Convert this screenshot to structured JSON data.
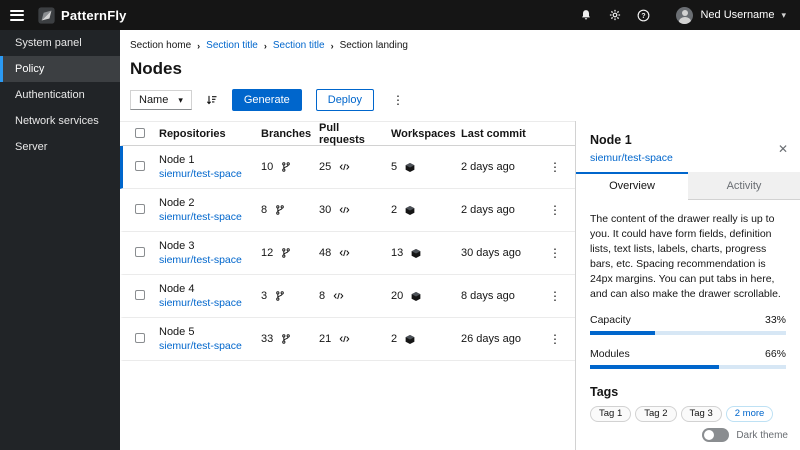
{
  "masthead": {
    "brand": "PatternFly",
    "username": "Ned Username"
  },
  "sidebar": {
    "items": [
      {
        "label": "System panel"
      },
      {
        "label": "Policy"
      },
      {
        "label": "Authentication"
      },
      {
        "label": "Network services"
      },
      {
        "label": "Server"
      }
    ]
  },
  "breadcrumb": {
    "items": [
      {
        "label": "Section home"
      },
      {
        "label": "Section title"
      },
      {
        "label": "Section title"
      },
      {
        "label": "Section landing"
      }
    ]
  },
  "page": {
    "title": "Nodes"
  },
  "toolbar": {
    "filter_label": "Name",
    "generate_label": "Generate",
    "deploy_label": "Deploy"
  },
  "table": {
    "headers": {
      "repositories": "Repositories",
      "branches": "Branches",
      "pulls": "Pull requests",
      "workspaces": "Workspaces",
      "last_commit": "Last commit"
    },
    "rows": [
      {
        "name": "Node 1",
        "repo": "siemur/test-space",
        "branches": "10",
        "pulls": "25",
        "workspaces": "5",
        "commit": "2 days ago"
      },
      {
        "name": "Node 2",
        "repo": "siemur/test-space",
        "branches": "8",
        "pulls": "30",
        "workspaces": "2",
        "commit": "2 days ago"
      },
      {
        "name": "Node 3",
        "repo": "siemur/test-space",
        "branches": "12",
        "pulls": "48",
        "workspaces": "13",
        "commit": "30 days ago"
      },
      {
        "name": "Node 4",
        "repo": "siemur/test-space",
        "branches": "3",
        "pulls": "8",
        "workspaces": "20",
        "commit": "8 days ago"
      },
      {
        "name": "Node 5",
        "repo": "siemur/test-space",
        "branches": "33",
        "pulls": "21",
        "workspaces": "2",
        "commit": "26 days ago"
      }
    ]
  },
  "drawer": {
    "title": "Node 1",
    "link": "siemur/test-space",
    "close": "✕",
    "tabs": {
      "overview": "Overview",
      "activity": "Activity"
    },
    "body_text": "The content of the drawer really is up to you. It could have form fields, definition lists, text lists, labels, charts, progress bars, etc. Spacing recommendation is 24px margins. You can put tabs in here, and can also make the drawer scrollable.",
    "progress": [
      {
        "label": "Capacity",
        "pct": "33%"
      },
      {
        "label": "Modules",
        "pct": "66%"
      }
    ],
    "tags_title": "Tags",
    "tags": [
      {
        "label": "Tag 1"
      },
      {
        "label": "Tag 2"
      },
      {
        "label": "Tag 3"
      }
    ],
    "tags_more": "2 more",
    "dark_theme_label": "Dark theme"
  },
  "colors": {
    "primary": "#0066cc",
    "masthead_bg": "#151515",
    "sidebar_bg": "#212427",
    "nav_active_accent": "#2b9af3",
    "progress_track": "#d7e7f5"
  }
}
